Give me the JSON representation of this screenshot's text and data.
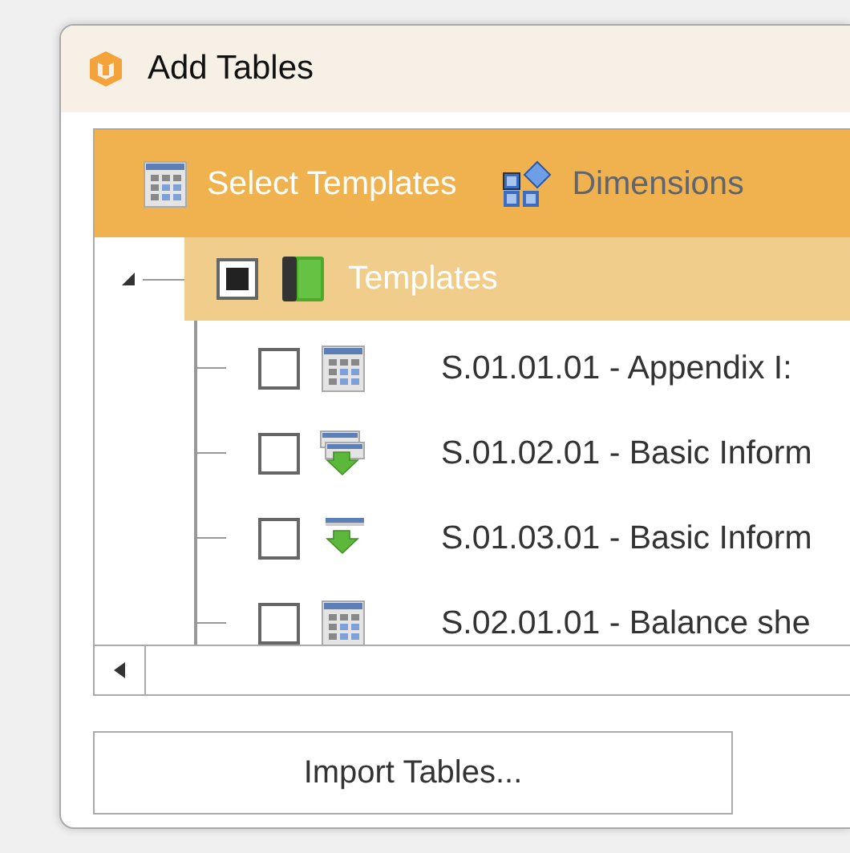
{
  "window": {
    "title": "Add Tables"
  },
  "tabs": [
    {
      "label": "Select Templates",
      "kind": "templates",
      "selected": true
    },
    {
      "label": "Dimensions",
      "kind": "dimensions",
      "selected": false
    }
  ],
  "tree": {
    "label": "Templates",
    "expanded": true,
    "checked": false,
    "indeterminate": true,
    "children": [
      {
        "label": "S.01.01.01 - Appendix I:",
        "kind": "table",
        "checked": false
      },
      {
        "label": "S.01.02.01 - Basic Inform",
        "kind": "table-import",
        "checked": false
      },
      {
        "label": "S.01.03.01 - Basic Inform",
        "kind": "import",
        "checked": false
      },
      {
        "label": "S.02.01.01 - Balance she",
        "kind": "table",
        "checked": false
      }
    ]
  },
  "buttons": [
    "Import Tables..."
  ]
}
